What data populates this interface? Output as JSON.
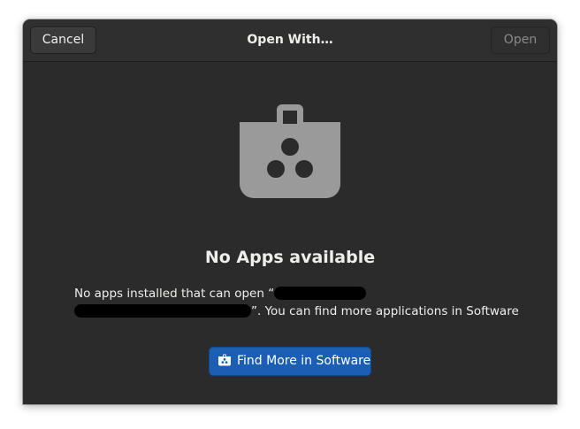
{
  "dialog": {
    "title": "Open With…",
    "cancel_label": "Cancel",
    "open_label": "Open"
  },
  "status": {
    "icon": "software-bag-icon",
    "title": "No Apps available",
    "desc_before": "No apps installed that can open “",
    "desc_after": "”. You can find more applications in Software"
  },
  "find_button": {
    "icon": "software-bag-icon",
    "label": "Find More in Software"
  },
  "colors": {
    "background": "#2b2b2b",
    "headerbar": "#2f2f2f",
    "suggested_action": "#1b5fb4",
    "icon_gray": "#9a9a9a"
  }
}
